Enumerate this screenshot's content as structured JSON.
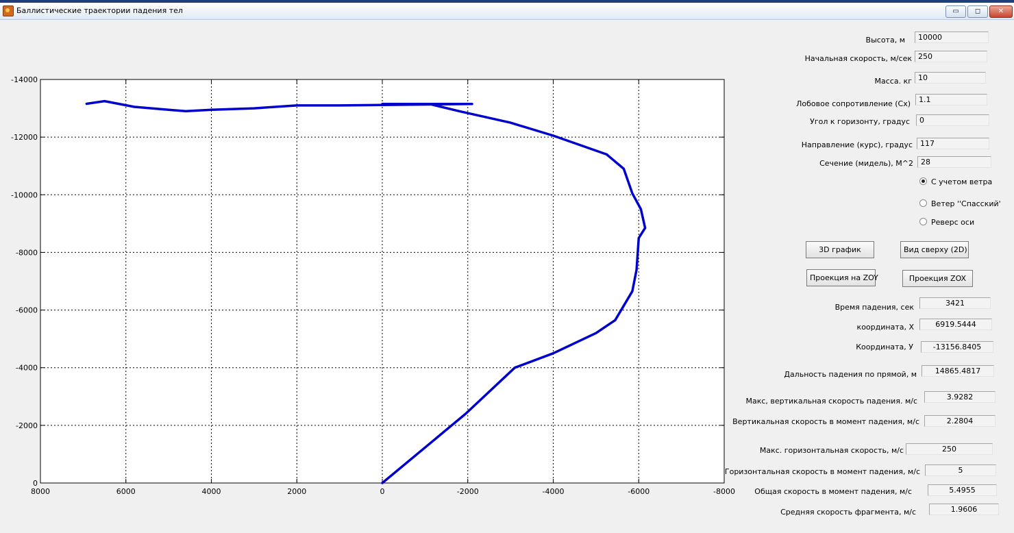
{
  "window": {
    "title": "Баллистические траектории падения тел",
    "minimize": "▭",
    "maximize": "◻",
    "close": "✕"
  },
  "params": [
    {
      "label": "Высота, м",
      "value": "10000"
    },
    {
      "label": "Начальная скорость, м/сек",
      "value": "250"
    },
    {
      "label": "Масса. кг",
      "value": "10"
    },
    {
      "label": "Лобовое сопротивление (Cx)",
      "value": "1.1"
    },
    {
      "label": "Угол к горизонту, градус",
      "value": "0"
    },
    {
      "label": "Направление  (курс), градус",
      "value": "117"
    },
    {
      "label": "Сечение (мидель), М^2",
      "value": "28"
    }
  ],
  "radios": [
    {
      "label": "С учетом ветра",
      "checked": true
    },
    {
      "label": "Ветер ''Спасский'",
      "checked": false
    },
    {
      "label": "Реверс оси",
      "checked": false
    }
  ],
  "buttons": {
    "plot3d": "3D график",
    "top2d": "Вид сверху (2D)",
    "zoy": "Проекция на ZOY",
    "zox": "Проекция ZOX"
  },
  "results": [
    {
      "label": "Время падения, сек",
      "value": "3421"
    },
    {
      "label": "координата, X",
      "value": "6919.5444"
    },
    {
      "label": "Координата, У",
      "value": "-13156.8405"
    },
    {
      "label": "Дальность падения по прямой, м",
      "value": "14865.4817"
    },
    {
      "label": "Макс,  вертикальная скорость падения. м/с",
      "value": "3.9282"
    },
    {
      "label": "Вертикальная  скорость в момент падения, м/с",
      "value": "2.2804"
    },
    {
      "label": "Макс. горизонтальная скорость, м/с",
      "value": "250"
    },
    {
      "label": "Горизонтальная скорость в момент падения, м/с",
      "value": "5"
    },
    {
      "label": "Общая скорость в момент падения, м/с",
      "value": "5.4955"
    },
    {
      "label": "Средняя скорость фрагмента, м/с",
      "value": "1.9606"
    }
  ],
  "chart_data": {
    "type": "line",
    "xlim": [
      8000,
      -8000
    ],
    "ylim": [
      0,
      -14000
    ],
    "grid": true,
    "x_ticks": [
      "8000",
      "6000",
      "4000",
      "2000",
      "0",
      "-2000",
      "-4000",
      "-6000",
      "-8000"
    ],
    "y_ticks": [
      "0",
      "-2000",
      "-4000",
      "-6000",
      "-8000",
      "-10000",
      "-12000",
      "-14000"
    ],
    "series": [
      {
        "color": "#0000cc",
        "x": [
          0,
          -1950,
          -3100,
          -4000,
          -5000,
          -5450,
          -5850,
          -5950,
          -6000,
          -6150,
          -6050,
          -5850,
          -5650,
          -5250,
          -4000,
          -3000,
          -1800,
          -1100,
          0,
          -500,
          -1200,
          -2100,
          1000,
          2000,
          3000,
          4000,
          4600,
          5000,
          5800,
          6500,
          6920
        ],
        "y": [
          0,
          -2400,
          -4000,
          -4500,
          -5200,
          -5650,
          -6650,
          -7400,
          -8500,
          -8850,
          -9500,
          -10050,
          -10900,
          -11400,
          -12050,
          -12500,
          -12900,
          -13150,
          -13150,
          -13150,
          -13150,
          -13150,
          -13100,
          -13100,
          -13000,
          -12950,
          -12900,
          -12950,
          -13050,
          -13250,
          -13157
        ]
      }
    ]
  }
}
